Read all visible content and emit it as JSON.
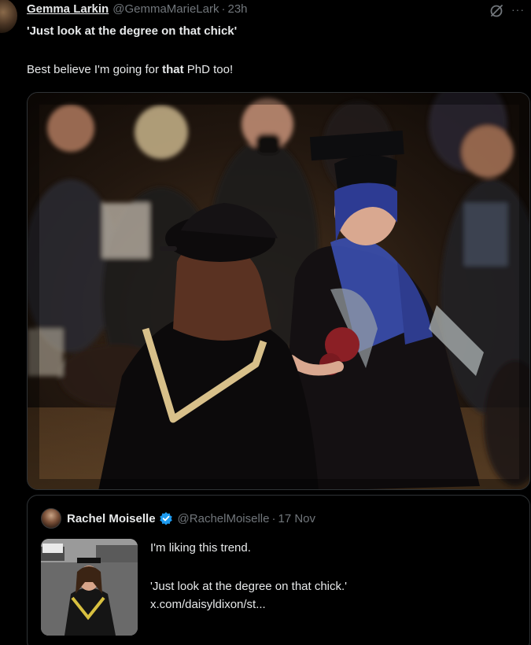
{
  "tweet": {
    "author_name": "Gemma Larkin",
    "author_handle": "@GemmaMarieLark",
    "separator": "·",
    "timestamp": "23h",
    "text_line1_part1": "'Just look at the ",
    "text_line1_part2": "degree on that chick",
    "text_line1_part3": "'",
    "text_line2_part1": "Best believe I'm going for ",
    "text_line2_part2": "that",
    "text_line2_part3": " PhD too!",
    "grok_icon": "grok-slash-circle-icon",
    "more_icon": "more-dots-icon",
    "more_glyph": "···"
  },
  "quoted_tweet": {
    "author_name": "Rachel Moiselle",
    "verified_icon": "verified-badge-icon",
    "author_handle": "@RachelMoiselle",
    "separator": "·",
    "date": "17 Nov",
    "text_line1": "I'm liking this trend.",
    "text_line2": "'Just look at the degree on that chick.'",
    "text_line3": "x.com/daisyldixon/st..."
  },
  "colors": {
    "background": "#000000",
    "text_primary": "#e7e9ea",
    "text_secondary": "#71767b",
    "border": "#2f3336",
    "verified_blue": "#1d9bf0"
  }
}
